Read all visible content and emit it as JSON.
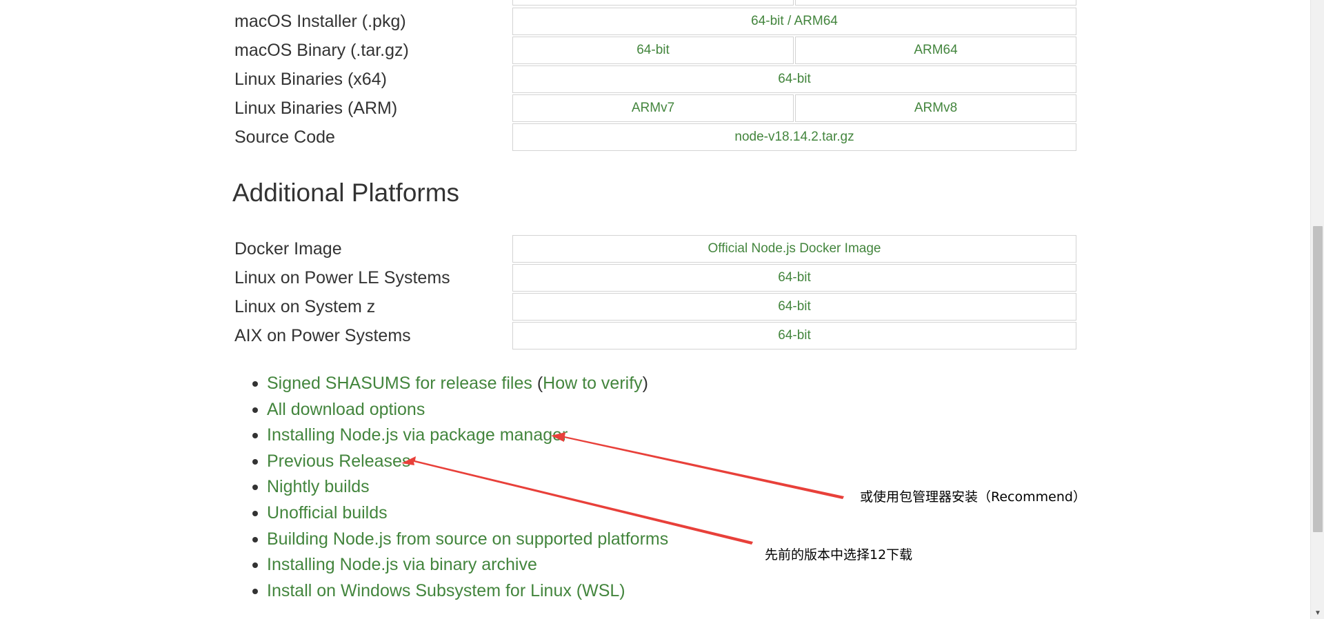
{
  "download_table": {
    "rows": [
      {
        "label": "",
        "cells": [
          "",
          ""
        ]
      },
      {
        "label": "macOS Installer (.pkg)",
        "cells": [
          "64-bit / ARM64"
        ]
      },
      {
        "label": "macOS Binary (.tar.gz)",
        "cells": [
          "64-bit",
          "ARM64"
        ]
      },
      {
        "label": "Linux Binaries (x64)",
        "cells": [
          "64-bit"
        ]
      },
      {
        "label": "Linux Binaries (ARM)",
        "cells": [
          "ARMv7",
          "ARMv8"
        ]
      },
      {
        "label": "Source Code",
        "cells": [
          "node-v18.14.2.tar.gz"
        ]
      }
    ]
  },
  "additional": {
    "heading": "Additional Platforms",
    "rows": [
      {
        "label": "Docker Image",
        "cells": [
          "Official Node.js Docker Image"
        ]
      },
      {
        "label": "Linux on Power LE Systems",
        "cells": [
          "64-bit"
        ]
      },
      {
        "label": "Linux on System z",
        "cells": [
          "64-bit"
        ]
      },
      {
        "label": "AIX on Power Systems",
        "cells": [
          "64-bit"
        ]
      }
    ]
  },
  "links": {
    "shasums_main": "Signed SHASUMS for release files",
    "paren_open": "(",
    "how_to_verify": "How to verify",
    "paren_close": ")",
    "items": [
      "All download options",
      "Installing Node.js via package manager",
      "Previous Releases",
      "Nightly builds",
      "Unofficial builds",
      "Building Node.js from source on supported platforms",
      "Installing Node.js via binary archive",
      "Install on Windows Subsystem for Linux (WSL)"
    ]
  },
  "annotations": {
    "package_manager_note": "或使用包管理器安装（Recommend）",
    "previous_releases_note": "先前的版本中选择12下载",
    "arrow_color": "#e8403a"
  },
  "colors": {
    "link": "#43853d",
    "text": "#333333",
    "cell_border": "#d3d3d3"
  },
  "icons": {
    "bullet": "bullet-dot",
    "scroll_down": "triangle-down"
  }
}
